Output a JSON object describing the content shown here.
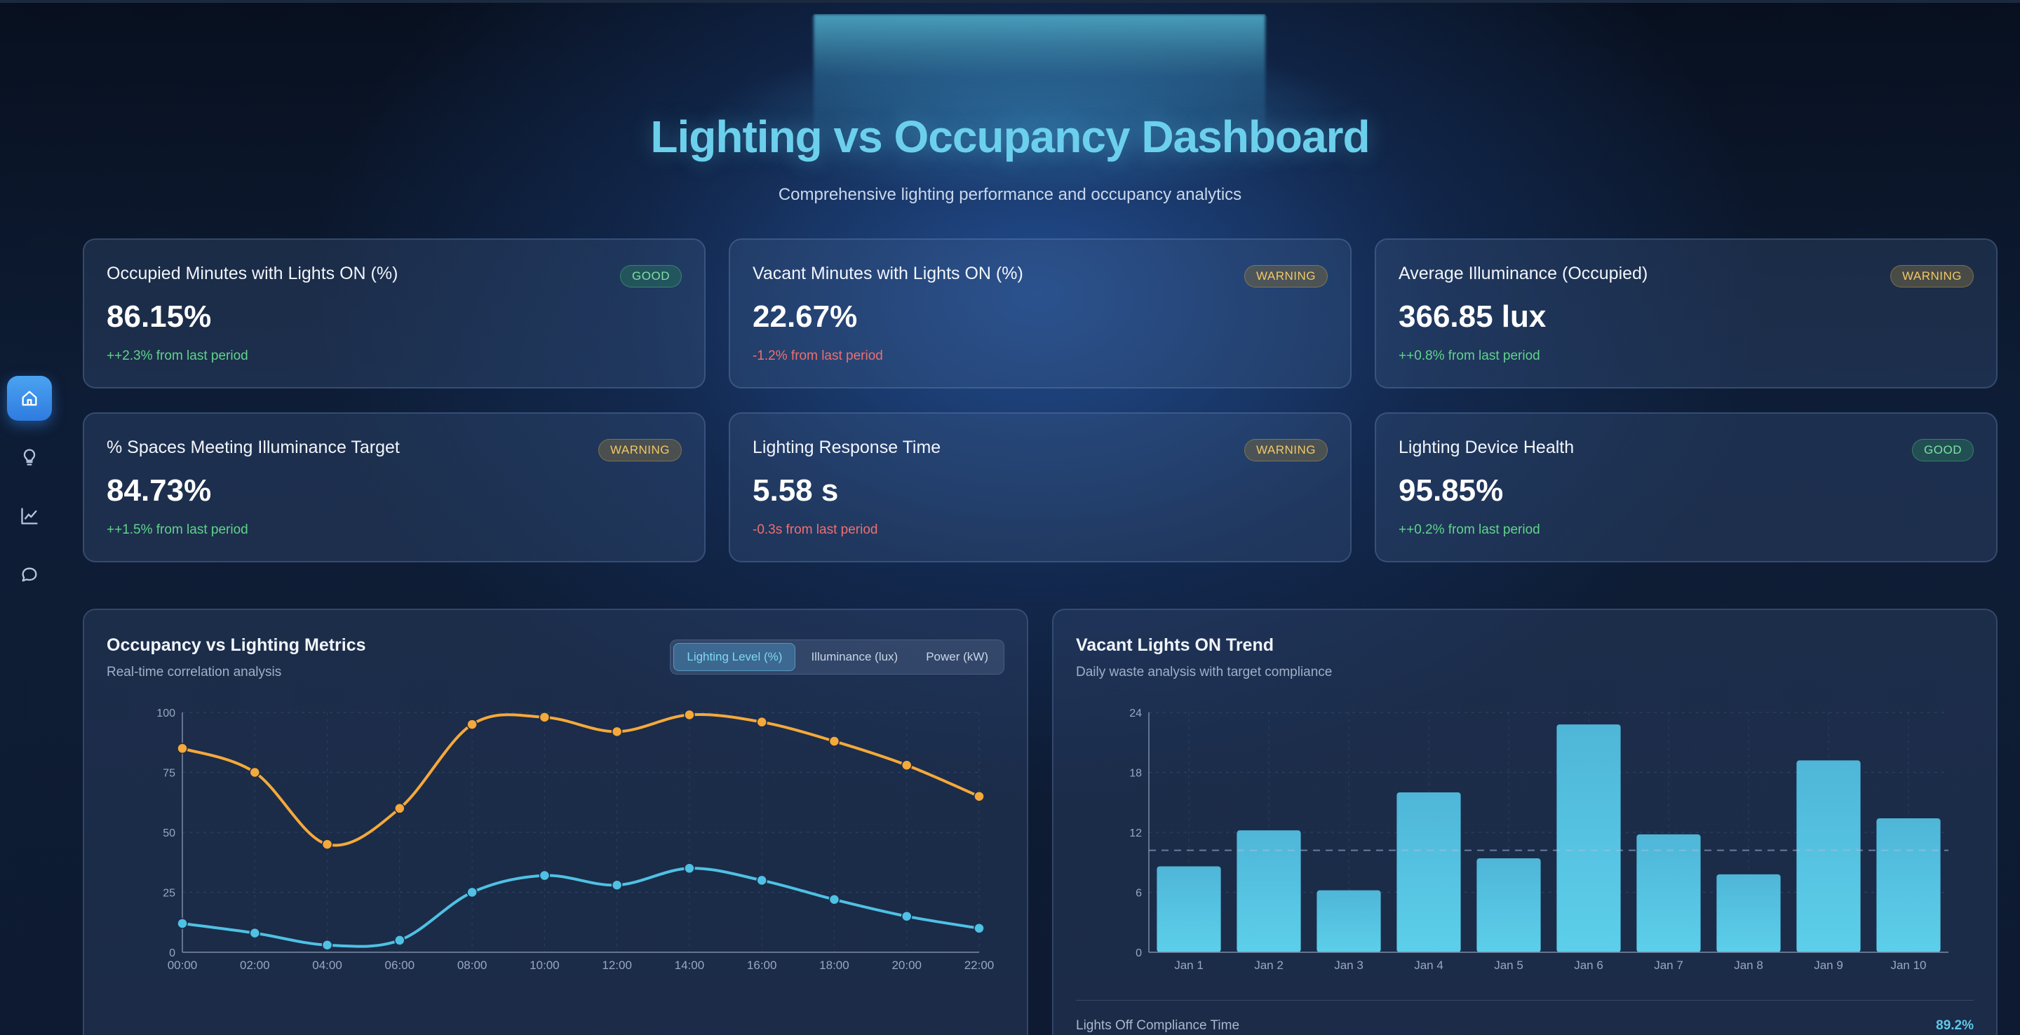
{
  "header": {
    "title": "Lighting vs Occupancy Dashboard",
    "subtitle": "Comprehensive lighting performance and occupancy analytics"
  },
  "sidebar": {
    "items": [
      {
        "icon": "home-icon",
        "active": true
      },
      {
        "icon": "lightbulb-icon",
        "active": false
      },
      {
        "icon": "line-chart-icon",
        "active": false
      },
      {
        "icon": "chat-icon",
        "active": false
      }
    ]
  },
  "metrics": [
    {
      "title": "Occupied Minutes with Lights ON (%)",
      "badge": "GOOD",
      "status": "good",
      "value": "86.15%",
      "change": "++2.3% from last period",
      "trend": "pos"
    },
    {
      "title": "Vacant Minutes with Lights ON (%)",
      "badge": "WARNING",
      "status": "warning",
      "value": "22.67%",
      "change": "-1.2% from last period",
      "trend": "neg"
    },
    {
      "title": "Average Illuminance (Occupied)",
      "badge": "WARNING",
      "status": "warning",
      "value": "366.85 lux",
      "change": "++0.8% from last period",
      "trend": "pos"
    },
    {
      "title": "% Spaces Meeting Illuminance Target",
      "badge": "WARNING",
      "status": "warning",
      "value": "84.73%",
      "change": "++1.5% from last period",
      "trend": "pos"
    },
    {
      "title": "Lighting Response Time",
      "badge": "WARNING",
      "status": "warning",
      "value": "5.58 s",
      "change": "-0.3s from last period",
      "trend": "neg"
    },
    {
      "title": "Lighting Device Health",
      "badge": "GOOD",
      "status": "good",
      "value": "95.85%",
      "change": "++0.2% from last period",
      "trend": "pos"
    }
  ],
  "colors": {
    "accent": "#6cd0ec",
    "series_orange": "#f5a93a",
    "series_blue": "#4fc1e4",
    "bar": "#55c3e3",
    "good": "#5fd48a",
    "warning": "#f0c868",
    "negative": "#ef6f6f"
  },
  "panels": {
    "left": {
      "title": "Occupancy vs Lighting Metrics",
      "subtitle": "Real-time correlation analysis",
      "toggles": [
        {
          "label": "Lighting Level (%)",
          "active": true
        },
        {
          "label": "Illuminance (lux)",
          "active": false
        },
        {
          "label": "Power (kW)",
          "active": false
        }
      ]
    },
    "right": {
      "title": "Vacant Lights ON Trend",
      "subtitle": "Daily waste analysis with target compliance",
      "footer_label": "Lights Off Compliance Time",
      "footer_value": "89.2%"
    }
  },
  "chart_data": [
    {
      "type": "line",
      "x": [
        "00:00",
        "02:00",
        "04:00",
        "06:00",
        "08:00",
        "10:00",
        "12:00",
        "14:00",
        "16:00",
        "18:00",
        "20:00",
        "22:00"
      ],
      "ylim": [
        0,
        100
      ],
      "yticks": [
        0,
        25,
        50,
        75,
        100
      ],
      "grid": true,
      "series": [
        {
          "color": "#f5a93a",
          "values": [
            85,
            75,
            45,
            60,
            95,
            98,
            92,
            99,
            96,
            88,
            78,
            65
          ]
        },
        {
          "color": "#4fc1e4",
          "values": [
            12,
            8,
            3,
            5,
            25,
            32,
            28,
            35,
            30,
            22,
            15,
            10
          ]
        }
      ]
    },
    {
      "type": "bar",
      "categories": [
        "Jan 1",
        "Jan 2",
        "Jan 3",
        "Jan 4",
        "Jan 5",
        "Jan 6",
        "Jan 7",
        "Jan 8",
        "Jan 9",
        "Jan 10"
      ],
      "values": [
        8.6,
        12.2,
        6.2,
        16,
        9.4,
        22.8,
        11.8,
        7.8,
        19.2,
        13.4
      ],
      "ylim": [
        0,
        24
      ],
      "yticks": [
        0,
        6,
        12,
        18,
        24
      ],
      "target": 10.2,
      "grid": true
    }
  ]
}
